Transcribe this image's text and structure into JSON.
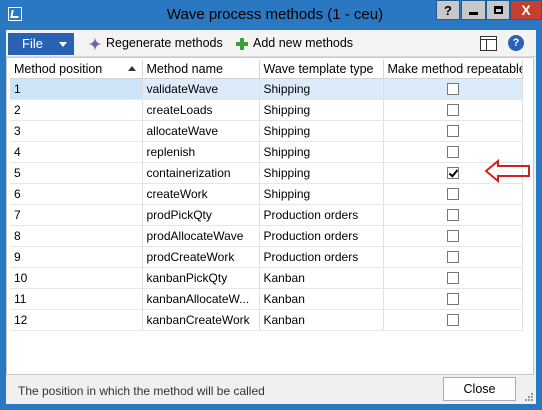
{
  "window": {
    "title": "Wave process methods (1 - ceu)",
    "controls": {
      "help": "?",
      "close": "X"
    }
  },
  "toolbar": {
    "file_label": "File",
    "regenerate_label": "Regenerate methods",
    "add_label": "Add new methods"
  },
  "grid": {
    "columns": [
      "Method position",
      "Method name",
      "Wave template type",
      "Make method repeatable"
    ],
    "sorted_column": "Method position",
    "rows": [
      {
        "position": "1",
        "name": "validateWave",
        "type": "Shipping",
        "repeatable": false,
        "selected": true
      },
      {
        "position": "2",
        "name": "createLoads",
        "type": "Shipping",
        "repeatable": false
      },
      {
        "position": "3",
        "name": "allocateWave",
        "type": "Shipping",
        "repeatable": false
      },
      {
        "position": "4",
        "name": "replenish",
        "type": "Shipping",
        "repeatable": false
      },
      {
        "position": "5",
        "name": "containerization",
        "type": "Shipping",
        "repeatable": true
      },
      {
        "position": "6",
        "name": "createWork",
        "type": "Shipping",
        "repeatable": false
      },
      {
        "position": "7",
        "name": "prodPickQty",
        "type": "Production orders",
        "repeatable": false
      },
      {
        "position": "8",
        "name": "prodAllocateWave",
        "type": "Production orders",
        "repeatable": false
      },
      {
        "position": "9",
        "name": "prodCreateWork",
        "type": "Production orders",
        "repeatable": false
      },
      {
        "position": "10",
        "name": "kanbanPickQty",
        "type": "Kanban",
        "repeatable": false
      },
      {
        "position": "11",
        "name": "kanbanAllocateW...",
        "type": "Kanban",
        "repeatable": false
      },
      {
        "position": "12",
        "name": "kanbanCreateWork",
        "type": "Kanban",
        "repeatable": false
      }
    ]
  },
  "annotation": {
    "arrow_color": "#d02020",
    "target_row": "5"
  },
  "statusbar": {
    "text": "The position in which the method will be called",
    "close_label": "Close"
  },
  "colors": {
    "titlebar": "#2b78c2",
    "file_button": "#2a62b3",
    "selected_row": "#dcebfa"
  }
}
